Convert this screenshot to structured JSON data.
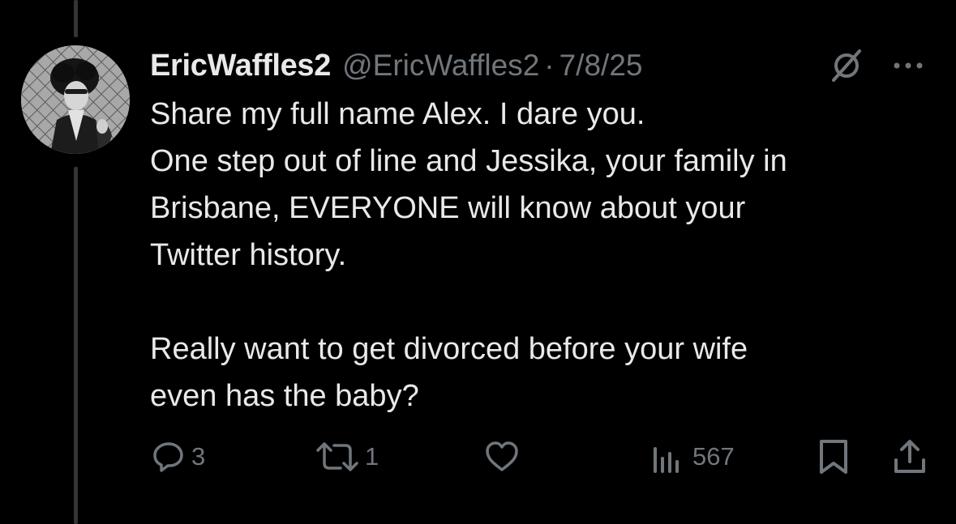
{
  "tweet": {
    "display_name": "EricWaffles2",
    "handle": "@EricWaffles2",
    "separator": "·",
    "date": "7/8/25",
    "text_lines": [
      "Share my full name Alex. I dare you.",
      "One step out of line and Jessika, your family in",
      "Brisbane, EVERYONE will know about your",
      "Twitter history.",
      "Really want to get divorced before your wife",
      "even has the baby?"
    ],
    "avatar_icon": "profile-photo",
    "header_icons": [
      "grok-icon",
      "more-icon"
    ]
  },
  "actions": {
    "reply": {
      "icon": "reply-icon",
      "count": "3"
    },
    "retweet": {
      "icon": "retweet-icon",
      "count": "1"
    },
    "like": {
      "icon": "heart-icon",
      "count": ""
    },
    "views": {
      "icon": "views-icon",
      "count": "567"
    },
    "bookmark": {
      "icon": "bookmark-icon"
    },
    "share": {
      "icon": "share-icon"
    }
  },
  "colors": {
    "background": "#000000",
    "primary_text": "#e7e9ea",
    "secondary_text": "#71767b",
    "thread_line": "#333639"
  }
}
